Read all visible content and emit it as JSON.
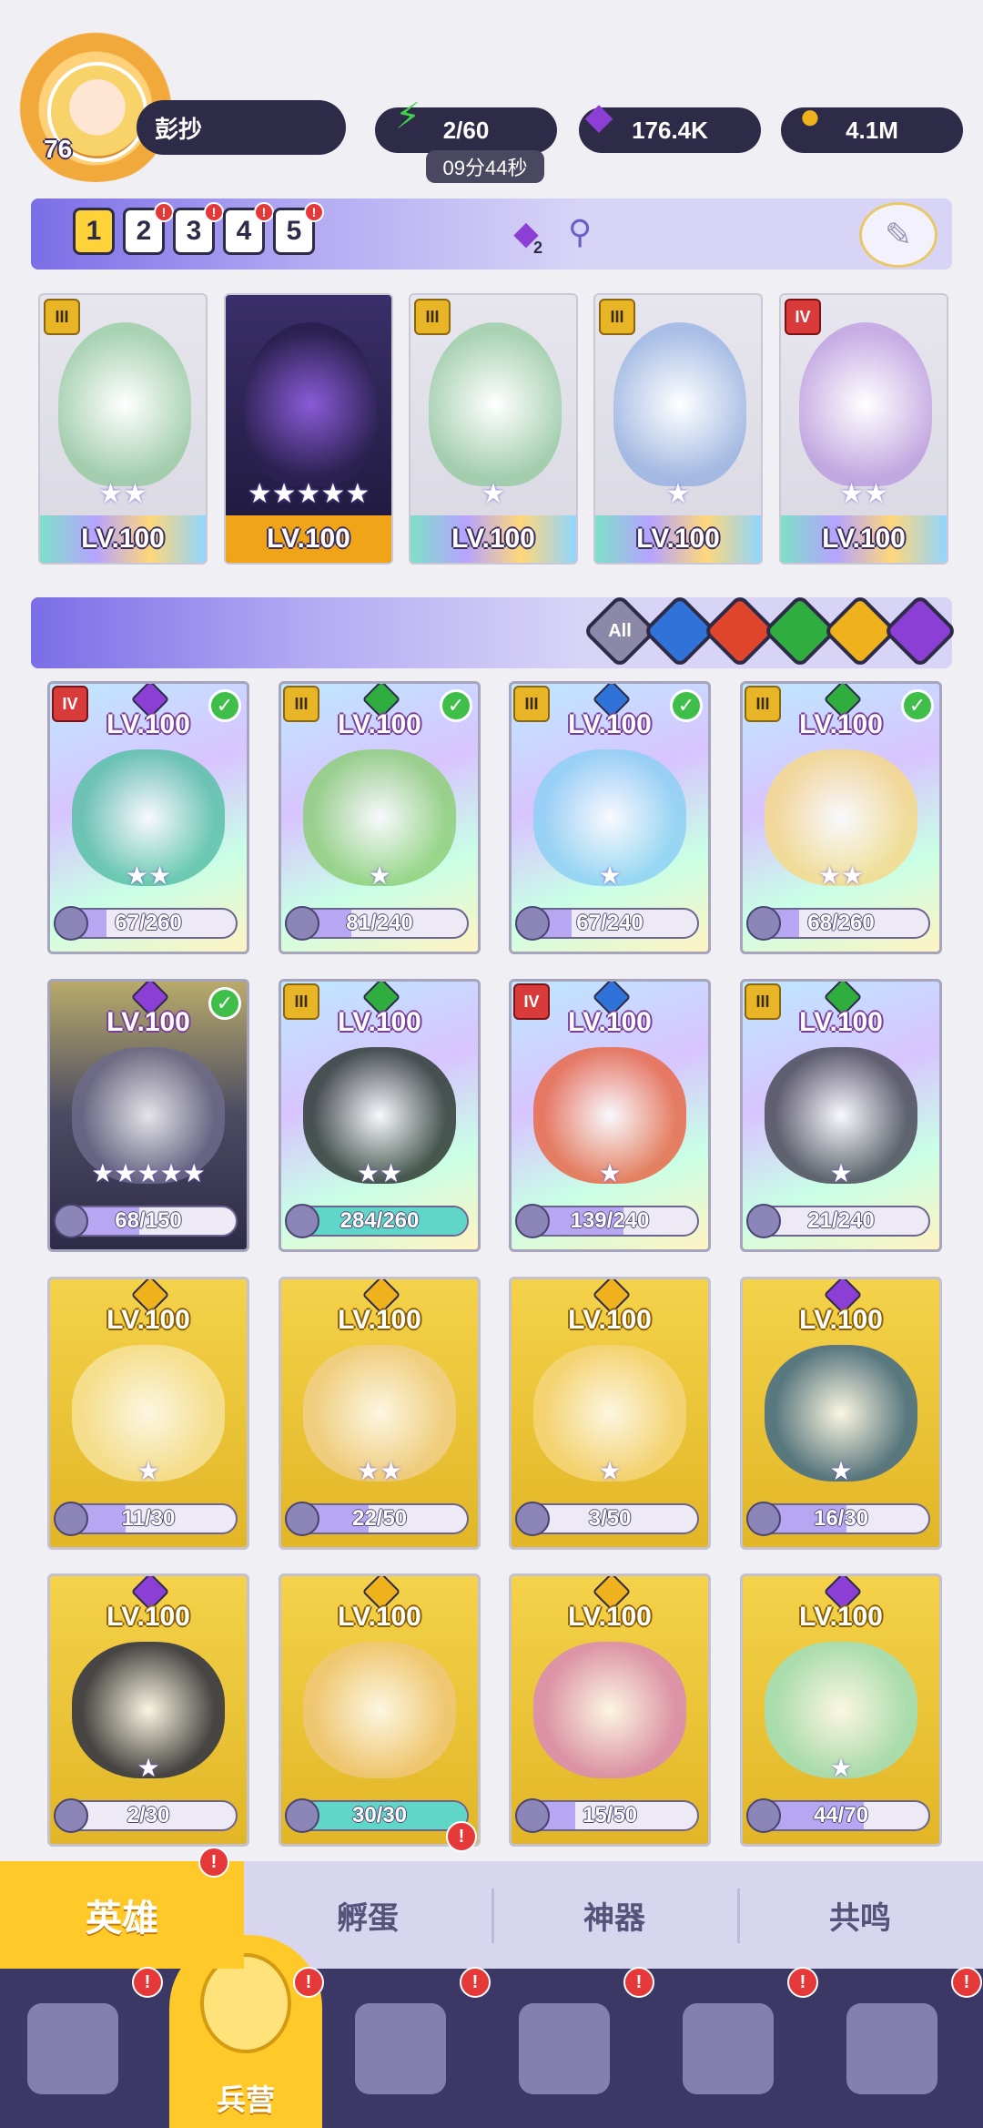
{
  "player": {
    "level": "76",
    "name": "彭抄"
  },
  "resources": {
    "energy": "2/60",
    "energy_timer": "09分44秒",
    "gems": "176.4K",
    "gold": "4.1M"
  },
  "teams": {
    "tabs": [
      "1",
      "2",
      "3",
      "4",
      "5"
    ],
    "active": "1",
    "gem_count": "2"
  },
  "formation": [
    {
      "tier": "III",
      "level": "LV.100",
      "stars": "★★",
      "style": "holo",
      "element_color": "#2fae3f"
    },
    {
      "tier": "",
      "level": "LV.100",
      "stars": "★★★★★",
      "style": "dark",
      "element_color": "#8b3fd4"
    },
    {
      "tier": "III",
      "level": "LV.100",
      "stars": "★",
      "style": "holo",
      "element_color": "#2fae3f"
    },
    {
      "tier": "III",
      "level": "LV.100",
      "stars": "★",
      "style": "holo",
      "element_color": "#2f73d9"
    },
    {
      "tier": "IV",
      "level": "LV.100",
      "stars": "★★",
      "style": "holo",
      "element_color": "#8b3fd4"
    }
  ],
  "filters": {
    "all_label": "All",
    "elements": [
      {
        "name": "water",
        "color": "#2f73d9"
      },
      {
        "name": "fire",
        "color": "#e0462c"
      },
      {
        "name": "nature",
        "color": "#2fae3f"
      },
      {
        "name": "light",
        "color": "#f0b21c"
      },
      {
        "name": "dark",
        "color": "#8b3fd4"
      }
    ]
  },
  "heroes": [
    {
      "tier": "IV",
      "level": "LV.100",
      "stars": "★★",
      "fragments": "67/260",
      "progress": 0.26,
      "check": true,
      "style": "holo",
      "element_color": "#8b3fd4",
      "art": "#5ac0a8"
    },
    {
      "tier": "III",
      "level": "LV.100",
      "stars": "★",
      "fragments": "81/240",
      "progress": 0.34,
      "check": true,
      "style": "holo",
      "element_color": "#2fae3f",
      "art": "#8fcf7a"
    },
    {
      "tier": "III",
      "level": "LV.100",
      "stars": "★",
      "fragments": "67/240",
      "progress": 0.28,
      "check": true,
      "style": "holo",
      "element_color": "#2f73d9",
      "art": "#8ed0f4"
    },
    {
      "tier": "III",
      "level": "LV.100",
      "stars": "★★",
      "fragments": "68/260",
      "progress": 0.26,
      "check": true,
      "style": "holo",
      "element_color": "#2fae3f",
      "art": "#f6d98a"
    },
    {
      "tier": "",
      "level": "LV.100",
      "stars": "★★★★★",
      "fragments": "68/150",
      "progress": 0.45,
      "check": true,
      "style": "dark",
      "element_color": "#8b3fd4",
      "art": "#6d6a8a"
    },
    {
      "tier": "III",
      "level": "LV.100",
      "stars": "★★",
      "fragments": "284/260",
      "progress": 1.0,
      "check": false,
      "style": "holo",
      "element_color": "#2fae3f",
      "art": "#2f3a34"
    },
    {
      "tier": "IV",
      "level": "LV.100",
      "stars": "★",
      "fragments": "139/240",
      "progress": 0.58,
      "check": false,
      "style": "holo",
      "element_color": "#2f73d9",
      "art": "#e86a4a"
    },
    {
      "tier": "III",
      "level": "LV.100",
      "stars": "★",
      "fragments": "21/240",
      "progress": 0.09,
      "check": false,
      "style": "holo",
      "element_color": "#2fae3f",
      "art": "#4b4b58"
    },
    {
      "tier": "",
      "level": "LV.100",
      "stars": "★",
      "fragments": "11/30",
      "progress": 0.37,
      "check": false,
      "style": "gold",
      "element_color": "#f0b21c",
      "art": "#f6e29a"
    },
    {
      "tier": "",
      "level": "LV.100",
      "stars": "★★",
      "fragments": "22/50",
      "progress": 0.44,
      "check": false,
      "style": "gold",
      "element_color": "#f0b21c",
      "art": "#f0cf8a"
    },
    {
      "tier": "",
      "level": "LV.100",
      "stars": "★",
      "fragments": "3/50",
      "progress": 0.06,
      "check": false,
      "style": "gold",
      "element_color": "#f0b21c",
      "art": "#f5d57a"
    },
    {
      "tier": "",
      "level": "LV.100",
      "stars": "★",
      "fragments": "16/30",
      "progress": 0.53,
      "check": false,
      "style": "gold",
      "element_color": "#8b3fd4",
      "art": "#3f6a8a"
    },
    {
      "tier": "",
      "level": "LV.100",
      "stars": "★",
      "fragments": "2/30",
      "progress": 0.07,
      "check": false,
      "style": "gold",
      "element_color": "#8b3fd4",
      "art": "#2a2f45"
    },
    {
      "tier": "",
      "level": "LV.100",
      "stars": "",
      "fragments": "30/30",
      "progress": 1.0,
      "check": false,
      "style": "gold",
      "element_color": "#f0b21c",
      "art": "#f0c77a"
    },
    {
      "tier": "",
      "level": "LV.100",
      "stars": "",
      "fragments": "15/50",
      "progress": 0.3,
      "check": false,
      "style": "gold",
      "element_color": "#f0b21c",
      "art": "#d98ab8"
    },
    {
      "tier": "",
      "level": "LV.100",
      "stars": "★",
      "fragments": "44/70",
      "progress": 0.63,
      "check": false,
      "style": "gold",
      "element_color": "#8b3fd4",
      "art": "#9fe0c0"
    }
  ],
  "sub_tabs": [
    "英雄",
    "孵蛋",
    "神器",
    "共鸣"
  ],
  "nav": {
    "active_label": "兵营"
  },
  "alert_mark": "!"
}
